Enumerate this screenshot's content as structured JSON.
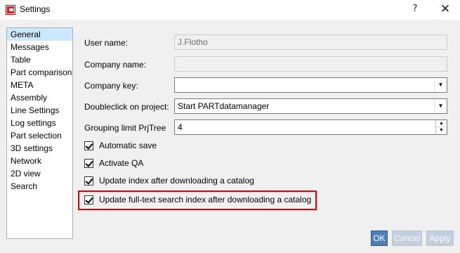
{
  "window": {
    "title": "Settings",
    "help_glyph": "?",
    "close_glyph": "✕"
  },
  "sidebar": {
    "items": [
      {
        "label": "General",
        "selected": true
      },
      {
        "label": "Messages"
      },
      {
        "label": "Table"
      },
      {
        "label": "Part comparison"
      },
      {
        "label": "META"
      },
      {
        "label": "Assembly"
      },
      {
        "label": "Line Settings"
      },
      {
        "label": "Log settings"
      },
      {
        "label": "Part selection"
      },
      {
        "label": "3D settings"
      },
      {
        "label": "Network"
      },
      {
        "label": "2D view"
      },
      {
        "label": "Search"
      }
    ]
  },
  "form": {
    "user_name": {
      "label": "User name:",
      "value": "J.Flotho",
      "disabled": true
    },
    "company_name": {
      "label": "Company name:",
      "value": "",
      "disabled": true
    },
    "company_key": {
      "label": "Company key:",
      "value": ""
    },
    "doubleclick": {
      "label": "Doubleclick on project:",
      "value": "Start PARTdatamanager"
    },
    "grouping": {
      "label": "Grouping limit PrjTree",
      "value": "4"
    }
  },
  "checkboxes": [
    {
      "label": "Automatic save",
      "checked": true
    },
    {
      "label": "Activate QA",
      "checked": true
    },
    {
      "label": "Update index after downloading a catalog",
      "checked": true
    },
    {
      "label": "Update full-text search index after downloading a catalog",
      "checked": true,
      "highlighted": true
    }
  ],
  "buttons": {
    "ok": "OK",
    "cancel": "Cancel",
    "apply": "Apply"
  },
  "colors": {
    "highlight": "#e00000",
    "selection": "#cce8ff",
    "ok_button": "#4d7fb8"
  }
}
